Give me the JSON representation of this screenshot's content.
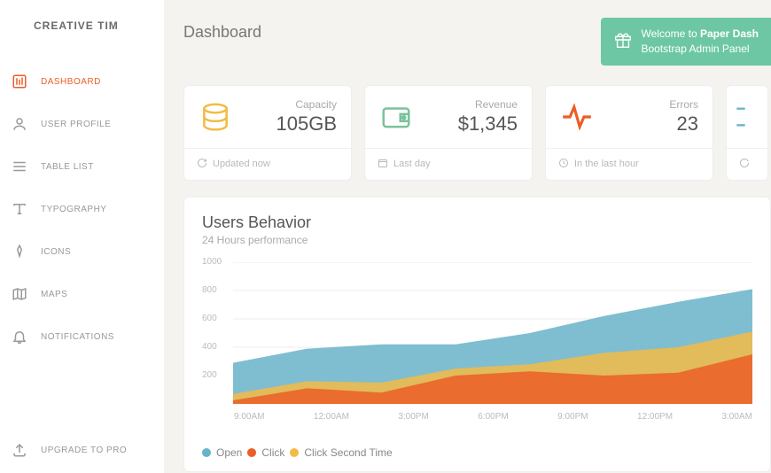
{
  "brand": "CREATIVE TIM",
  "page_title": "Dashboard",
  "nav": [
    {
      "label": "DASHBOARD"
    },
    {
      "label": "USER PROFILE"
    },
    {
      "label": "TABLE LIST"
    },
    {
      "label": "TYPOGRAPHY"
    },
    {
      "label": "ICONS"
    },
    {
      "label": "MAPS"
    },
    {
      "label": "NOTIFICATIONS"
    }
  ],
  "upgrade_label": "UPGRADE TO PRO",
  "welcome_line1": "Welcome to ",
  "welcome_bold": "Paper Dash",
  "welcome_line2": "Bootstrap Admin Panel",
  "cards": [
    {
      "label": "Capacity",
      "value": "105GB",
      "footer": "Updated now"
    },
    {
      "label": "Revenue",
      "value": "$1,345",
      "footer": "Last day"
    },
    {
      "label": "Errors",
      "value": "23",
      "footer": "In the last hour"
    }
  ],
  "chart": {
    "title": "Users Behavior",
    "subtitle": "24 Hours performance"
  },
  "legend": {
    "s1": "Open",
    "s2": "Click",
    "s3": "Click Second Time"
  },
  "chart_data": {
    "type": "area",
    "x": [
      "9:00AM",
      "12:00AM",
      "3:00PM",
      "6:00PM",
      "9:00PM",
      "12:00PM",
      "3:00AM"
    ],
    "yticks": [
      200,
      400,
      600,
      800,
      1000
    ],
    "ylim": [
      0,
      1000
    ],
    "series": [
      {
        "name": "Open",
        "color": "#68b3c8",
        "values": [
          290,
          390,
          420,
          420,
          500,
          620,
          720,
          810
        ]
      },
      {
        "name": "Click Second Time",
        "color": "#f3bb45",
        "values": [
          70,
          160,
          150,
          250,
          280,
          360,
          400,
          510
        ]
      },
      {
        "name": "Click",
        "color": "#eb5e28",
        "values": [
          25,
          110,
          80,
          200,
          230,
          200,
          220,
          350
        ]
      }
    ]
  }
}
